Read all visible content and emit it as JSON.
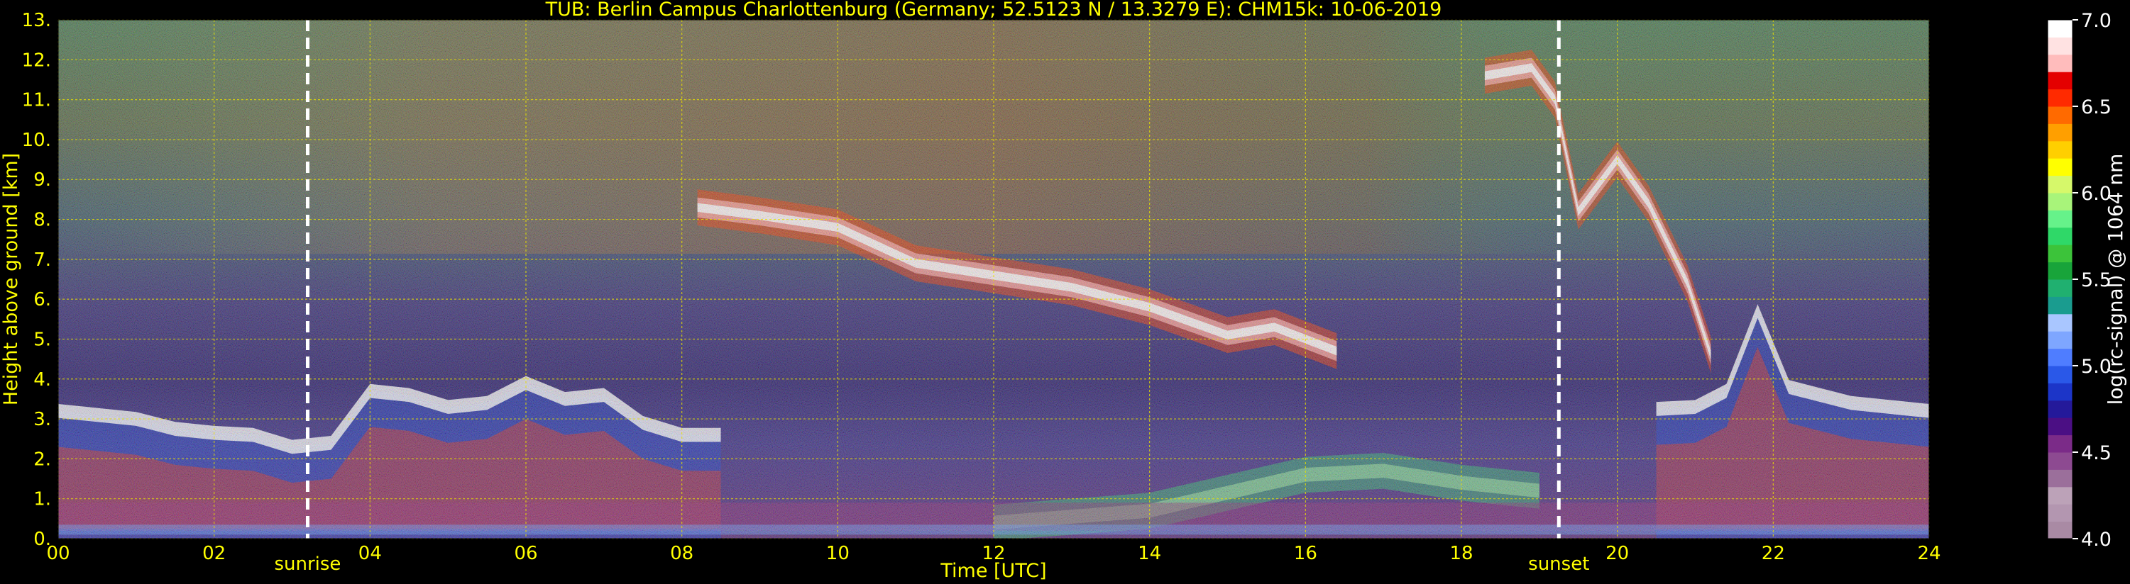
{
  "chart_data": {
    "type": "heatmap",
    "title": "TUB: Berlin Campus Charlottenburg (Germany; 52.5123 N / 13.3279 E):    CHM15k: 10-06-2019",
    "xlabel": "Time [UTC]",
    "ylabel": "Height above ground [km]",
    "x_ticks": [
      "00",
      "02",
      "04",
      "06",
      "08",
      "10",
      "12",
      "14",
      "16",
      "18",
      "20",
      "22",
      "24"
    ],
    "y_ticks": [
      "0.",
      "1.",
      "2.",
      "3.",
      "4.",
      "5.",
      "6.",
      "7.",
      "8.",
      "9.",
      "10.",
      "11.",
      "12.",
      "13."
    ],
    "xlim": [
      0,
      24
    ],
    "ylim": [
      0,
      13
    ],
    "grid": true,
    "events": [
      {
        "label": "sunrise",
        "time": 3.2
      },
      {
        "label": "sunset",
        "time": 19.25
      }
    ],
    "colorbar": {
      "label": "log(rc-signal) @ 1064 nm",
      "range": [
        4.0,
        7.0
      ],
      "ticks": [
        "4.0",
        "4.5",
        "5.0",
        "5.5",
        "6.0",
        "6.5",
        "7.0"
      ],
      "colors": [
        "#a98aa4",
        "#b396b0",
        "#bca2b8",
        "#9b6f9b",
        "#8d4a91",
        "#7b2b88",
        "#4b0f84",
        "#24199a",
        "#1c35c8",
        "#2a58e8",
        "#4f7dff",
        "#7ea6ff",
        "#a9c6ff",
        "#1a9c8f",
        "#20b070",
        "#18a43a",
        "#3cc33a",
        "#2fd868",
        "#66f28a",
        "#a8f47a",
        "#d6f86a",
        "#ffff00",
        "#ffcf00",
        "#ff9f00",
        "#ff6a00",
        "#ff2a00",
        "#e40000",
        "#ffbcbc",
        "#ffe2e2",
        "#ffffff"
      ]
    },
    "features": [
      {
        "kind": "boundary_layer_top",
        "points": [
          [
            0,
            3.2
          ],
          [
            0.5,
            3.1
          ],
          [
            1,
            3.0
          ],
          [
            1.5,
            2.75
          ],
          [
            2,
            2.65
          ],
          [
            2.5,
            2.6
          ],
          [
            3,
            2.3
          ],
          [
            3.5,
            2.4
          ],
          [
            4,
            3.7
          ],
          [
            4.5,
            3.6
          ],
          [
            5,
            3.3
          ],
          [
            5.5,
            3.4
          ],
          [
            6,
            3.9
          ],
          [
            6.5,
            3.5
          ],
          [
            7,
            3.6
          ],
          [
            7.5,
            2.9
          ],
          [
            8,
            2.6
          ],
          [
            8.5,
            2.6
          ]
        ]
      },
      {
        "kind": "cirrus",
        "points": [
          [
            8.2,
            8.3
          ],
          [
            9,
            8.1
          ],
          [
            10,
            7.8
          ],
          [
            11,
            6.9
          ],
          [
            12,
            6.6
          ],
          [
            13,
            6.3
          ],
          [
            14,
            5.8
          ],
          [
            15,
            5.1
          ],
          [
            15.6,
            5.3
          ],
          [
            16.4,
            4.7
          ]
        ]
      },
      {
        "kind": "cirrus",
        "points": [
          [
            18.3,
            11.6
          ],
          [
            18.9,
            11.8
          ],
          [
            19.2,
            11.0
          ],
          [
            19.5,
            8.2
          ],
          [
            20,
            9.5
          ],
          [
            20.4,
            8.4
          ],
          [
            20.9,
            6.4
          ],
          [
            21.2,
            4.6
          ]
        ]
      },
      {
        "kind": "boundary_layer_top",
        "points": [
          [
            20.5,
            3.25
          ],
          [
            21,
            3.3
          ],
          [
            21.4,
            3.7
          ],
          [
            21.8,
            5.7
          ],
          [
            22.2,
            3.8
          ],
          [
            22.6,
            3.6
          ],
          [
            23,
            3.4
          ],
          [
            24,
            3.2
          ]
        ]
      },
      {
        "kind": "aerosol_layer",
        "points": [
          [
            12,
            0.4
          ],
          [
            14,
            0.7
          ],
          [
            16,
            1.6
          ],
          [
            17,
            1.7
          ],
          [
            18,
            1.4
          ],
          [
            19,
            1.2
          ]
        ]
      }
    ]
  }
}
